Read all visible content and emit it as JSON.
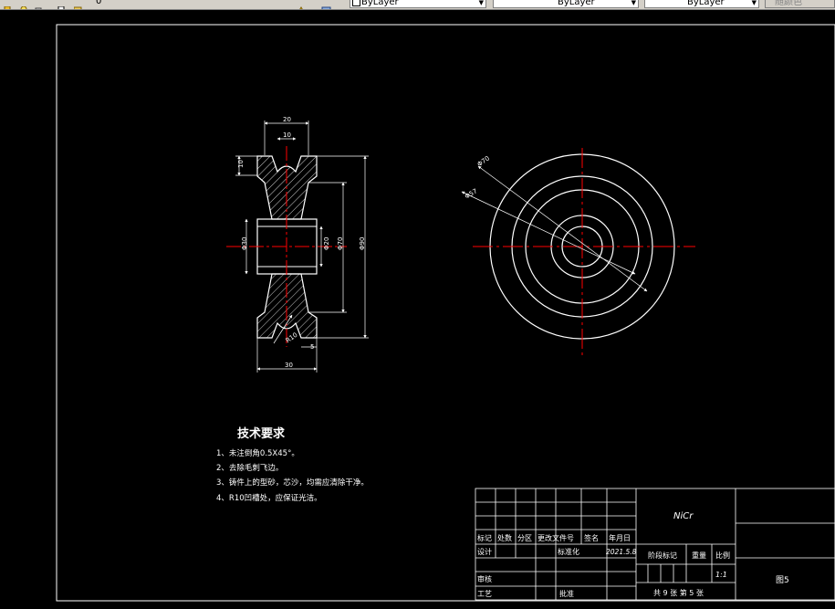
{
  "toolbar": {
    "layer_value": "0",
    "color_value": "ByLayer",
    "linetype_value": "ByLayer",
    "lineweight_value": "ByLayer",
    "plotstyle_value": "随颜色"
  },
  "drawing": {
    "section_view": {
      "dims": {
        "top_width": "20",
        "groove_width": "10",
        "groove_depth": "10",
        "bore_diameter": "Φ20",
        "hub_diameter": "Φ30",
        "inner_diameter": "Φ70",
        "outer_diameter": "Φ90",
        "groove_radius": "R10",
        "bottom_width": "30",
        "offset": "5"
      }
    },
    "end_view": {
      "dims": {
        "d1": "Φ70",
        "d2": "Φ57"
      }
    },
    "tech_requirements": {
      "title": "技术要求",
      "items": [
        "1、未注倒角0.5X45°。",
        "2、去除毛刺飞边。",
        "3、铸件上的型砂，芯沙，均需应清除干净。",
        "4、R10凹槽处，应保证光洁。"
      ]
    },
    "title_block": {
      "material": "NiCr",
      "headers": {
        "mark": "标记",
        "count": "处数",
        "zone": "分区",
        "change_doc": "更改文件号",
        "sign": "签名",
        "date": "年月日"
      },
      "design": "设计",
      "standardize": "标准化",
      "design_date": "2021.5.8",
      "stage_mark": "阶段标记",
      "weight": "重量",
      "scale": "比例",
      "scale_value": "1:1",
      "check": "审核",
      "process": "工艺",
      "approve": "批准",
      "sheets": "共 9 张 第 5 张",
      "drawing_name": "图5"
    }
  }
}
